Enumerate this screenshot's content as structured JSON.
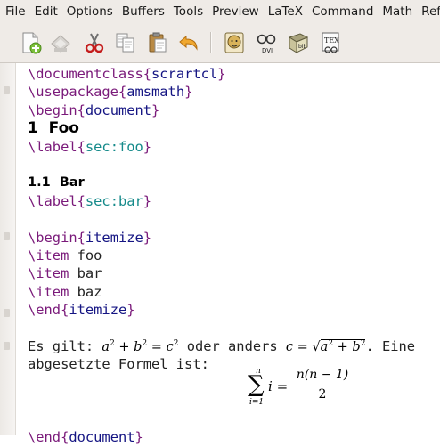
{
  "menu": [
    "File",
    "Edit",
    "Options",
    "Buffers",
    "Tools",
    "Preview",
    "LaTeX",
    "Command",
    "Math",
    "Ref"
  ],
  "toolbar": {
    "buttons": [
      {
        "icon": "new-document-icon"
      },
      {
        "icon": "save-disk-icon"
      },
      {
        "icon": "cut-scissors-icon"
      },
      {
        "icon": "copy-icon"
      },
      {
        "icon": "paste-icon"
      },
      {
        "icon": "undo-arrow-icon"
      },
      {
        "icon": "latex-lion-icon"
      },
      {
        "icon": "dvi-viewer-icon",
        "label": "DVI"
      },
      {
        "icon": "bibtex-icon",
        "label": "bib"
      },
      {
        "icon": "tex-document-icon",
        "label": "TEX"
      }
    ]
  },
  "source": {
    "l1_cmd": "\\documentclass",
    "l1_arg": "scrartcl",
    "l2_cmd": "\\usepackage",
    "l2_arg": "amsmath",
    "l3_cmd": "\\begin",
    "l3_arg": "document",
    "section_heading": "1  Foo",
    "l5_cmd": "\\label",
    "l5_arg": "sec:foo",
    "subsection_heading": "1.1  Bar",
    "l8_cmd": "\\label",
    "l8_arg": "sec:bar",
    "l10_cmd": "\\begin",
    "l10_arg": "itemize",
    "item_cmd": "\\item",
    "items": [
      "foo",
      "bar",
      "baz"
    ],
    "l14_cmd": "\\end",
    "l14_arg": "itemize",
    "para_lead": "Es gilt: ",
    "para_mid": " oder anders ",
    "para_tail": ". Eine",
    "para_line2": "abgesetzte Formel ist:",
    "inline_math_1": {
      "a": "a",
      "b": "b",
      "c": "c",
      "exp": "2",
      "plus": " + ",
      "eq": " = "
    },
    "inline_math_2": {
      "lhs": "c",
      "eq": " = ",
      "sqrt": "√",
      "radicand_a": "a",
      "radicand_b": "b",
      "exp": "2",
      "plus": " + "
    },
    "display_math": {
      "sum": "∑",
      "upper": "n",
      "lower": "i=1",
      "var": "i =",
      "numerator": "n(n − 1)",
      "denominator": "2"
    },
    "end_cmd": "\\end",
    "end_arg": "document"
  }
}
